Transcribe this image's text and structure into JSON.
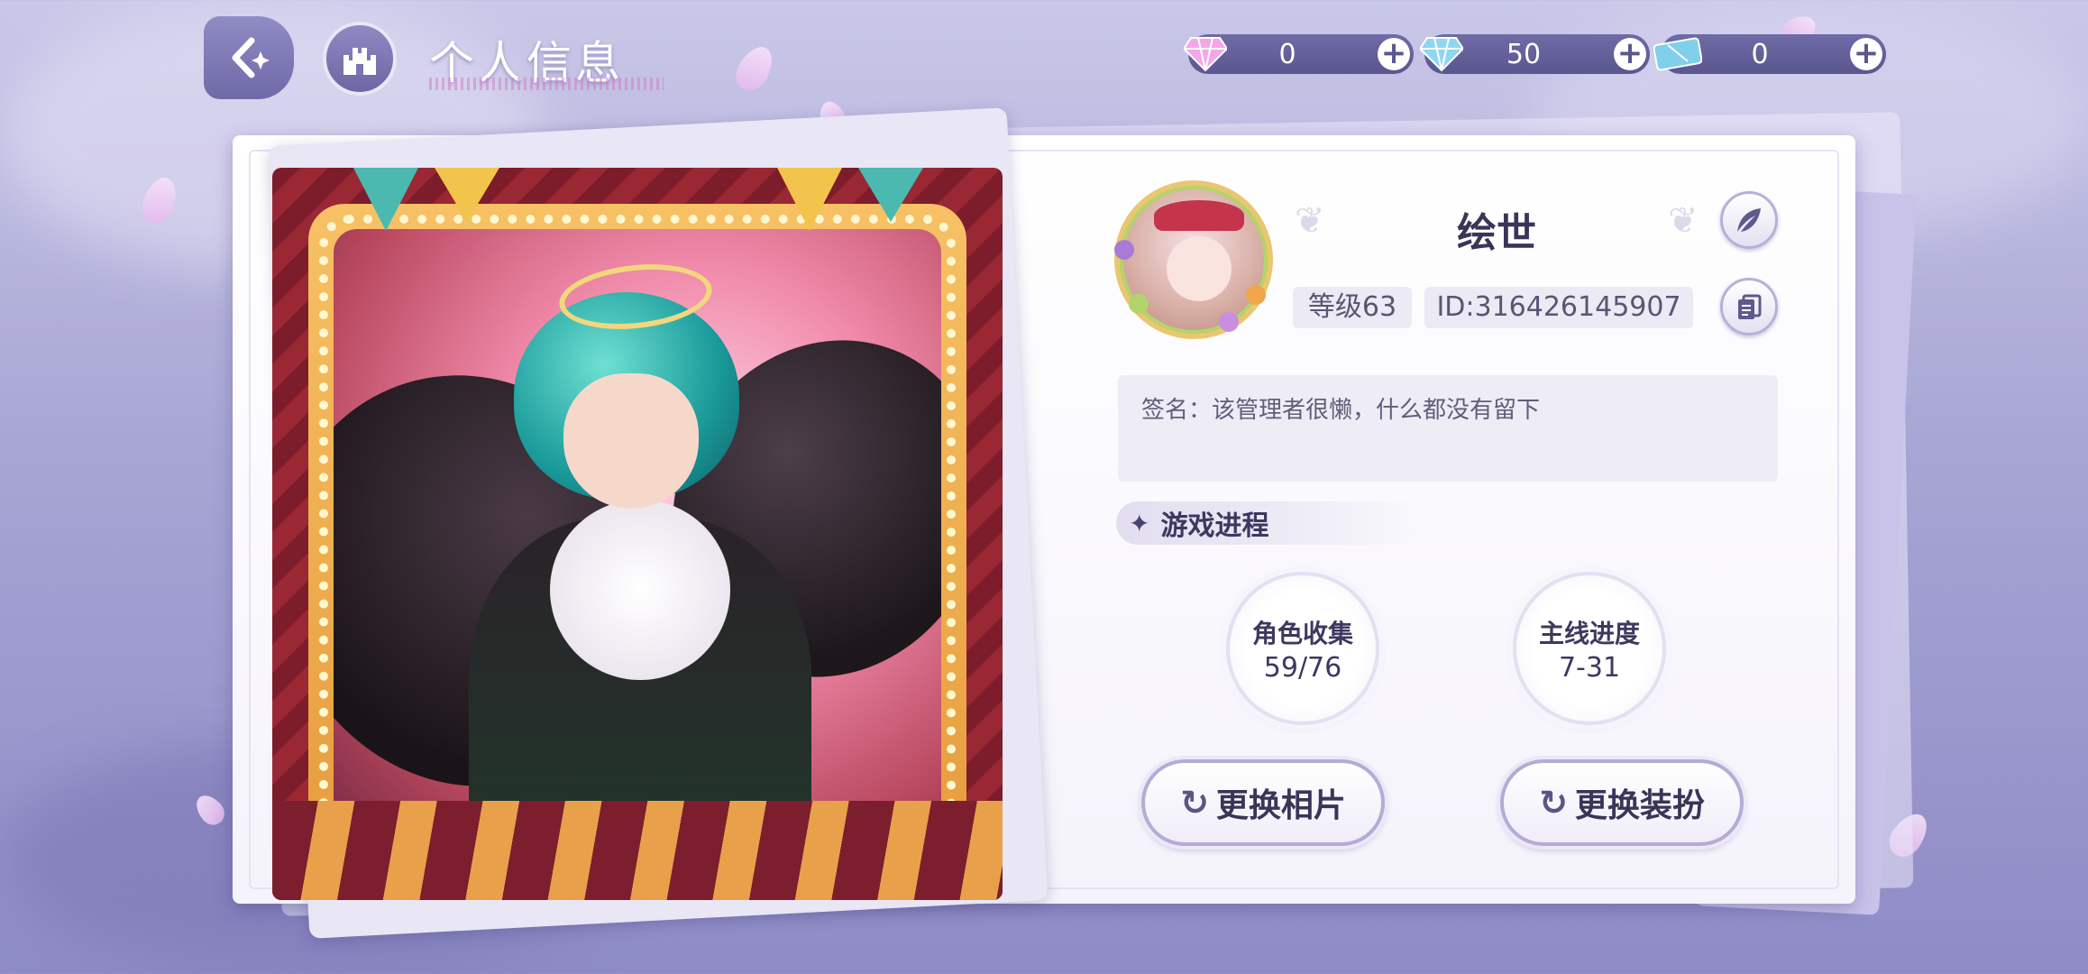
{
  "header": {
    "title": "个人信息",
    "back_icon": "back-arrow-icon",
    "home_icon": "castle-icon"
  },
  "currencies": [
    {
      "icon": "pink-diamond-icon",
      "value": "0"
    },
    {
      "icon": "blue-diamond-icon",
      "value": "50"
    },
    {
      "icon": "ticket-icon",
      "value": "0"
    }
  ],
  "profile": {
    "name": "绘世",
    "level": "等级63",
    "id": "ID:316426145907",
    "signature": "签名：该管理者很懒，什么都没有留下"
  },
  "progress": {
    "section_title": "游戏进程",
    "stats": [
      {
        "label": "角色收集",
        "value": "59/76"
      },
      {
        "label": "主线进度",
        "value": "7-31"
      }
    ]
  },
  "actions": {
    "change_photo": "更换相片",
    "change_outfit": "更换装扮"
  },
  "colors": {
    "accent": "#6f6ba6",
    "panel": "#ffffff",
    "text": "#3a3558"
  }
}
